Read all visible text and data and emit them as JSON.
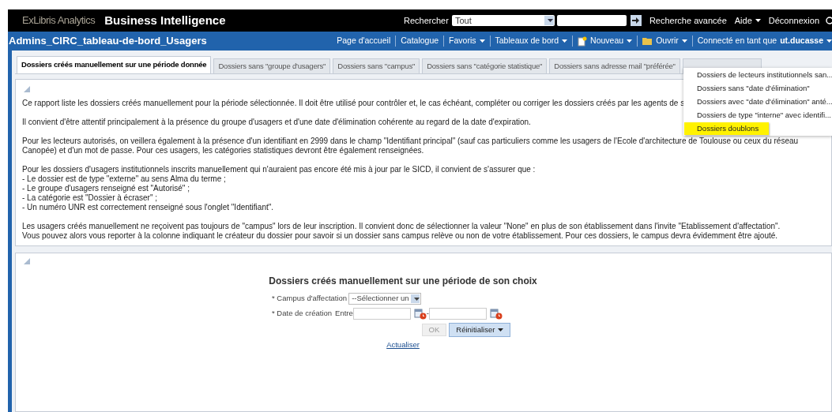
{
  "header": {
    "brand_light": "ExLibris Analytics",
    "brand_title": "Business Intelligence",
    "search_label": "Rechercher",
    "search_scope": "Tout",
    "links": [
      {
        "label": "Recherche avancée",
        "caret": false
      },
      {
        "label": "Aide",
        "caret": true
      },
      {
        "label": "Déconnexion",
        "caret": false
      }
    ]
  },
  "nav": {
    "title": "Admins_CIRC_tableau-de-bord_Usagers",
    "items": [
      {
        "label": "Page d'accueil",
        "caret": false,
        "kind": "link"
      },
      {
        "label": "Catalogue",
        "caret": false,
        "kind": "link"
      },
      {
        "label": "Favoris",
        "caret": true,
        "kind": "link"
      },
      {
        "label": "Tableaux de bord",
        "caret": true,
        "kind": "link"
      },
      {
        "label": "Nouveau",
        "caret": true,
        "kind": "new"
      },
      {
        "label": "Ouvrir",
        "caret": true,
        "kind": "open"
      }
    ],
    "user_prefix": "Connecté en tant que",
    "user": "ut.ducasse"
  },
  "tabs": [
    {
      "label": "Dossiers créés manuellement sur une période donnée",
      "selected": true
    },
    {
      "label": "Dossiers sans \"groupe d'usagers\"",
      "selected": false
    },
    {
      "label": "Dossiers sans \"campus\"",
      "selected": false
    },
    {
      "label": "Dossiers sans \"catégorie statistique\"",
      "selected": false
    },
    {
      "label": "Dossiers sans adresse mail \"préférée\"",
      "selected": false
    }
  ],
  "tab_menu": [
    {
      "label": "Dossiers de lecteurs institutionnels san...",
      "selected": false
    },
    {
      "label": "Dossiers sans \"date d'élimination\"",
      "selected": false
    },
    {
      "label": "Dossiers avec \"date d'élimination\" anté...",
      "selected": false
    },
    {
      "label": "Dossiers de type \"interne\" avec identifi...",
      "selected": false
    },
    {
      "label": "Dossiers doublons",
      "selected": true
    }
  ],
  "info_panel": {
    "paragraphs": [
      [
        "Ce rapport liste les dossiers créés manuellement pour la période sélectionnée. Il doit être utilisé pour contrôler et, le cas échéant, compléter ou corriger les dossiers créés par les agents de s"
      ],
      [
        "Il convient d'être attentif principalement à la présence du groupe d'usagers et d'une date d'élimination cohérente au regard de la date d'expiration."
      ],
      [
        "Pour les lecteurs autorisés, on veillera également à la présence d'un identifiant en 2999 dans le champ \"Identifiant principal\" (sauf cas particuliers comme les usagers de l'Ecole d'architecture de Toulouse ou ceux du réseau",
        "Canopée) et d'un mot de passe. Pour ces usagers, les catégories statistiques devront être également renseignées."
      ],
      [
        "Pour les dossiers d'usagers institutionnels inscrits manuellement qui n'auraient pas encore été mis à jour par le SICD, il convient de s'assurer que :",
        "- Le dossier est de type \"externe\" au sens Alma du terme ;",
        "- Le groupe d'usagers renseigné est \"Autorisé\" ;",
        "- La catégorie est \"Dossier à écraser\" ;",
        "- Un numéro UNR est correctement renseigné sous l'onglet \"Identifiant\"."
      ],
      [
        "Les usagers créés manuellement ne reçoivent pas toujours de \"campus\" lors de leur inscription. Il convient donc de sélectionner la valeur \"None\" en plus de son établissement dans l'invite \"Etablissement d'affectation\".",
        "Vous pouvez alors vous reporter à la colonne indiquant le créateur du dossier pour savoir si un dossier sans campus relève ou non de votre établissement. Pour ces dossiers, le campus devra évidemment être ajouté."
      ]
    ]
  },
  "prompt_panel": {
    "title": "Dossiers créés manuellement sur une période de son choix",
    "campus_label": "* Campus d'affectation",
    "campus_value": "--Sélectionner un",
    "date_label": "* Date de création",
    "between": "Entre",
    "separator": "-",
    "ok": {
      "label": "OK",
      "disabled": true
    },
    "reset": "Réinitialiser",
    "refresh": "Actualiser"
  }
}
